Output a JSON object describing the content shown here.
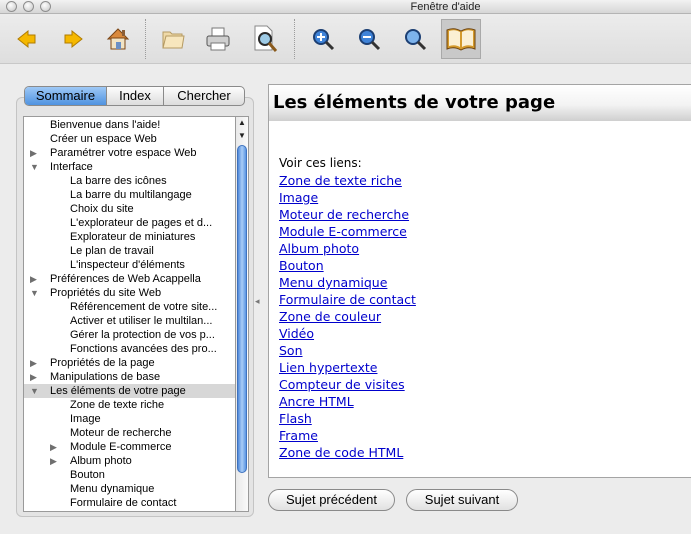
{
  "window": {
    "title": "Fenêtre d'aide"
  },
  "toolbar": {
    "buttons": [
      {
        "name": "back-button",
        "icon": "arrow-left-icon"
      },
      {
        "name": "forward-button",
        "icon": "arrow-right-icon"
      },
      {
        "name": "home-button",
        "icon": "home-icon"
      },
      {
        "name": "open-button",
        "icon": "folder-icon"
      },
      {
        "name": "print-button",
        "icon": "printer-icon"
      },
      {
        "name": "preview-button",
        "icon": "document-magnifier-icon"
      },
      {
        "name": "zoom-in-button",
        "icon": "zoom-in-icon"
      },
      {
        "name": "zoom-out-button",
        "icon": "zoom-out-icon"
      },
      {
        "name": "zoom-actual-button",
        "icon": "magnifier-icon"
      },
      {
        "name": "book-button",
        "icon": "book-icon"
      }
    ]
  },
  "sidebar": {
    "tabs": [
      {
        "label": "Sommaire",
        "selected": true
      },
      {
        "label": "Index",
        "selected": false
      },
      {
        "label": "Chercher",
        "selected": false
      }
    ],
    "tree": [
      {
        "label": "Bienvenue dans l'aide!",
        "level": 0,
        "disclosure": "none"
      },
      {
        "label": "Créer un espace Web",
        "level": 0,
        "disclosure": "none"
      },
      {
        "label": "Paramétrer votre espace Web",
        "level": 0,
        "disclosure": "collapsed"
      },
      {
        "label": "Interface",
        "level": 0,
        "disclosure": "expanded"
      },
      {
        "label": "La barre des icônes",
        "level": 1,
        "disclosure": "none"
      },
      {
        "label": "La barre du multilangage",
        "level": 1,
        "disclosure": "none"
      },
      {
        "label": "Choix du site",
        "level": 1,
        "disclosure": "none"
      },
      {
        "label": "L'explorateur de pages et d...",
        "level": 1,
        "disclosure": "none"
      },
      {
        "label": "Explorateur de miniatures",
        "level": 1,
        "disclosure": "none"
      },
      {
        "label": "Le plan de travail",
        "level": 1,
        "disclosure": "none"
      },
      {
        "label": "L'inspecteur d'éléments",
        "level": 1,
        "disclosure": "none"
      },
      {
        "label": "Préférences de Web Acappella",
        "level": 0,
        "disclosure": "collapsed"
      },
      {
        "label": "Propriétés du site Web",
        "level": 0,
        "disclosure": "expanded"
      },
      {
        "label": "Référencement de votre site...",
        "level": 1,
        "disclosure": "none"
      },
      {
        "label": "Activer et utiliser le multilan...",
        "level": 1,
        "disclosure": "none"
      },
      {
        "label": "Gérer la protection de vos p...",
        "level": 1,
        "disclosure": "none"
      },
      {
        "label": "Fonctions avancées des pro...",
        "level": 1,
        "disclosure": "none"
      },
      {
        "label": "Propriétés de la page",
        "level": 0,
        "disclosure": "collapsed"
      },
      {
        "label": "Manipulations de base",
        "level": 0,
        "disclosure": "collapsed"
      },
      {
        "label": "Les éléments de votre page",
        "level": 0,
        "disclosure": "expanded",
        "selected": true
      },
      {
        "label": "Zone de texte riche",
        "level": 1,
        "disclosure": "none"
      },
      {
        "label": "Image",
        "level": 1,
        "disclosure": "none"
      },
      {
        "label": "Moteur de recherche",
        "level": 1,
        "disclosure": "none"
      },
      {
        "label": "Module E-commerce",
        "level": 1,
        "disclosure": "collapsed"
      },
      {
        "label": "Album photo",
        "level": 1,
        "disclosure": "collapsed"
      },
      {
        "label": "Bouton",
        "level": 1,
        "disclosure": "none"
      },
      {
        "label": "Menu dynamique",
        "level": 1,
        "disclosure": "none"
      },
      {
        "label": "Formulaire de contact",
        "level": 1,
        "disclosure": "none"
      }
    ]
  },
  "content": {
    "title": "Les éléments de votre page",
    "intro": "Voir ces liens:",
    "links": [
      "Zone de texte riche",
      "Image",
      "Moteur de recherche",
      "Module E-commerce",
      "Album photo",
      "Bouton",
      "Menu dynamique",
      "Formulaire de contact",
      "Zone de couleur",
      "Vidéo",
      "Son",
      "Lien hypertexte",
      "Compteur de visites",
      "Ancre HTML",
      "Flash",
      "Frame",
      "Zone de code HTML"
    ]
  },
  "footer": {
    "prev_label": "Sujet précédent",
    "next_label": "Sujet suivant"
  },
  "colors": {
    "link": "#0000cc",
    "selection": "#d7d7d7",
    "accent": "#4f92e0",
    "arrow": "#f5b800"
  }
}
